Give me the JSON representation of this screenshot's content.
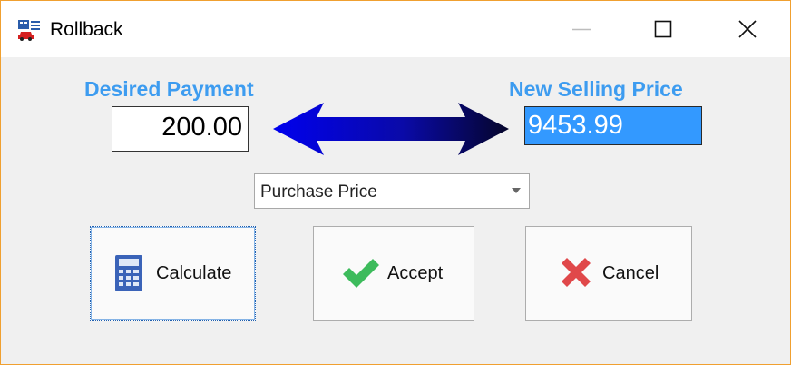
{
  "window": {
    "title": "Rollback",
    "icons": {
      "app": "calculator-car-icon",
      "minimize": "minimize-icon",
      "maximize": "maximize-icon",
      "close": "close-icon"
    }
  },
  "form": {
    "desired_payment_label": "Desired Payment",
    "desired_payment_value": "200.00",
    "new_selling_price_label": "New Selling Price",
    "new_selling_price_value": "9453.99",
    "arrow_icon": "double-arrow-icon",
    "basis_dropdown": {
      "selected": "Purchase Price"
    }
  },
  "buttons": {
    "calculate": {
      "label": "Calculate",
      "icon": "calculator-icon"
    },
    "accept": {
      "label": "Accept",
      "icon": "checkmark-icon"
    },
    "cancel": {
      "label": "Cancel",
      "icon": "x-icon"
    }
  },
  "colors": {
    "label_blue": "#3d9cf0",
    "selection_blue": "#3399ff",
    "arrow_blue": "#0000cc",
    "window_border": "#f0a030"
  }
}
